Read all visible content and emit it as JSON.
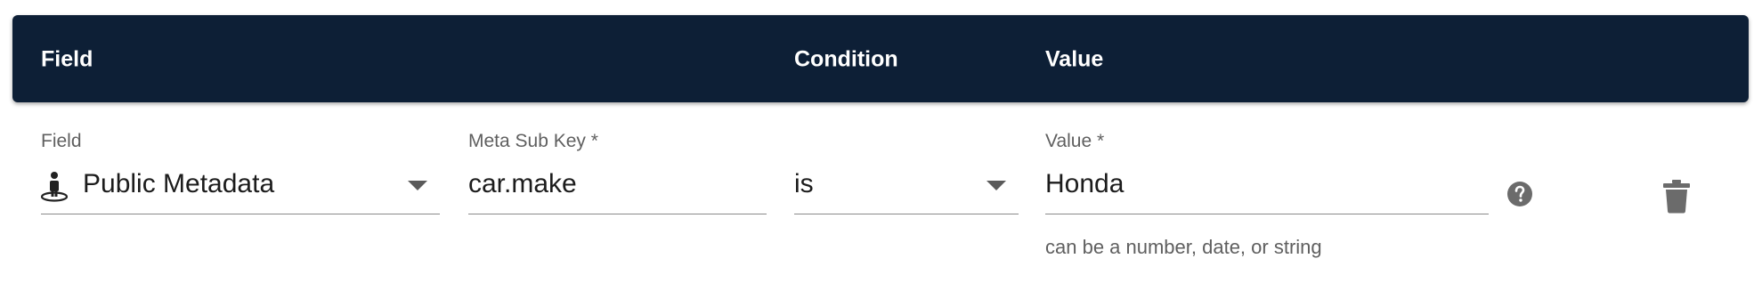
{
  "header": {
    "field": "Field",
    "condition": "Condition",
    "value": "Value"
  },
  "row": {
    "field": {
      "label": "Field",
      "value": "Public Metadata",
      "icon": "person-public-icon"
    },
    "meta_sub_key": {
      "label": "Meta Sub Key *",
      "value": "car.make"
    },
    "condition": {
      "value": "is"
    },
    "value": {
      "label": "Value *",
      "value": "Honda",
      "helper": "can be a number, date, or string"
    }
  },
  "colors": {
    "header_bg": "#0d1f36",
    "header_text": "#ffffff",
    "icon_gray": "#6b6b6b"
  }
}
